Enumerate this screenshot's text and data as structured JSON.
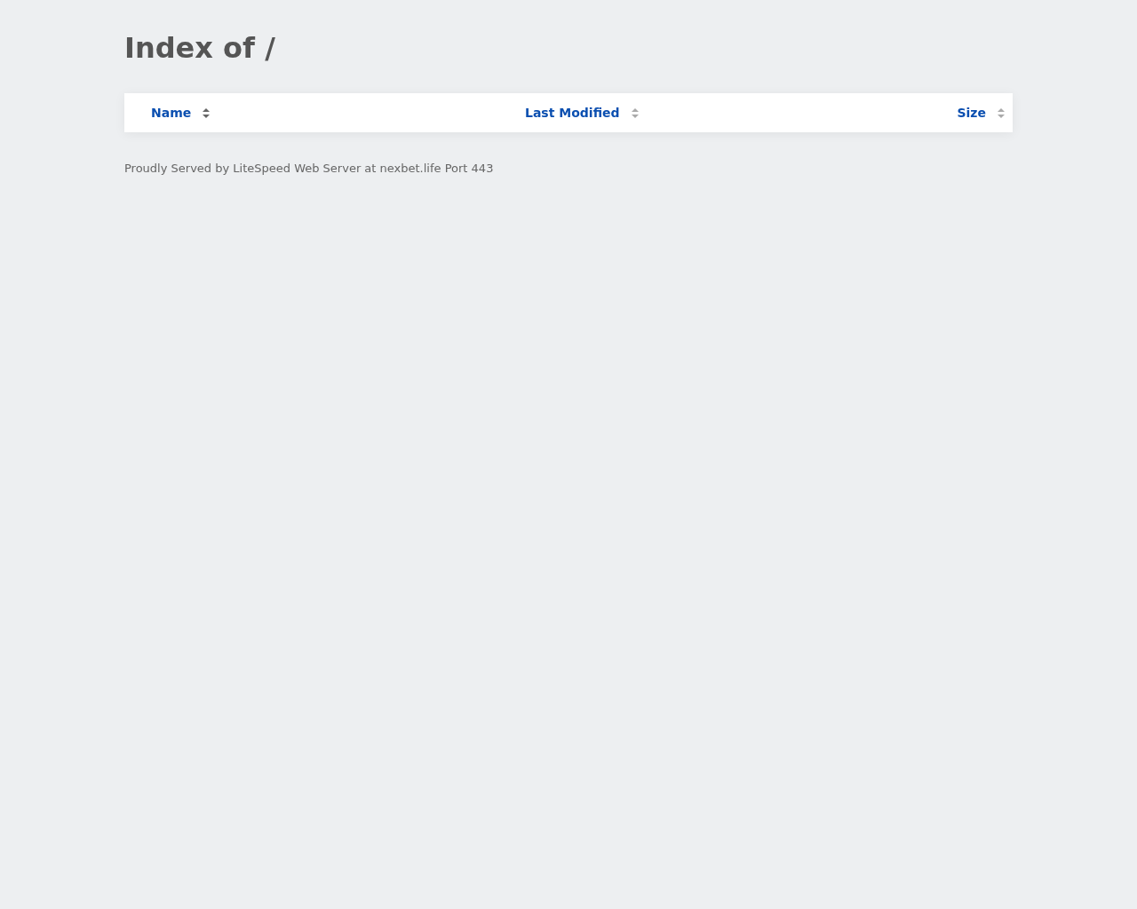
{
  "title": "Index of /",
  "table": {
    "columns": [
      {
        "label": "Name",
        "sorted": true
      },
      {
        "label": "Last Modified",
        "sorted": false
      },
      {
        "label": "Size",
        "sorted": false
      }
    ]
  },
  "footer": "Proudly Served by LiteSpeed Web Server at nexbet.life Port 443"
}
